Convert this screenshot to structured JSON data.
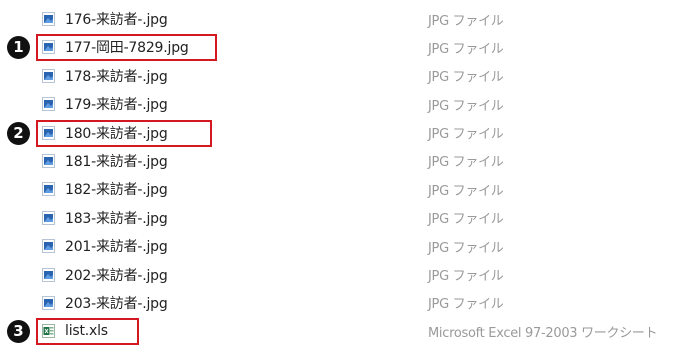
{
  "files": [
    {
      "name": "176-来訪者-.jpg",
      "type": "JPG ファイル",
      "icon": "jpg-image-icon",
      "highlighted": false
    },
    {
      "name": "177-岡田-7829.jpg",
      "type": "JPG ファイル",
      "icon": "jpg-image-icon",
      "highlighted": true,
      "marker": "1"
    },
    {
      "name": "178-来訪者-.jpg",
      "type": "JPG ファイル",
      "icon": "jpg-image-icon",
      "highlighted": false
    },
    {
      "name": "179-来訪者-.jpg",
      "type": "JPG ファイル",
      "icon": "jpg-image-icon",
      "highlighted": false
    },
    {
      "name": "180-来訪者-.jpg",
      "type": "JPG ファイル",
      "icon": "jpg-image-icon",
      "highlighted": true,
      "marker": "2"
    },
    {
      "name": "181-来訪者-.jpg",
      "type": "JPG ファイル",
      "icon": "jpg-image-icon",
      "highlighted": false
    },
    {
      "name": "182-来訪者-.jpg",
      "type": "JPG ファイル",
      "icon": "jpg-image-icon",
      "highlighted": false
    },
    {
      "name": "183-来訪者-.jpg",
      "type": "JPG ファイル",
      "icon": "jpg-image-icon",
      "highlighted": false
    },
    {
      "name": "201-来訪者-.jpg",
      "type": "JPG ファイル",
      "icon": "jpg-image-icon",
      "highlighted": false
    },
    {
      "name": "202-来訪者-.jpg",
      "type": "JPG ファイル",
      "icon": "jpg-image-icon",
      "highlighted": false
    },
    {
      "name": "203-来訪者-.jpg",
      "type": "JPG ファイル",
      "icon": "jpg-image-icon",
      "highlighted": false
    },
    {
      "name": "list.xls",
      "type": "Microsoft Excel 97-2003 ワークシート",
      "icon": "excel-file-icon",
      "highlighted": true,
      "marker": "3"
    }
  ],
  "colors": {
    "highlight_border": "#d4181f",
    "marker_bg": "#111111",
    "jpg_icon_blue": "#2a63b0",
    "excel_green": "#217346"
  }
}
